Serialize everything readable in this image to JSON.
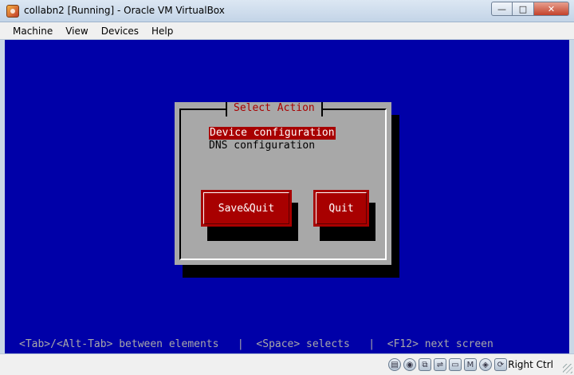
{
  "window": {
    "title": "collabn2 [Running] - Oracle VM VirtualBox",
    "minimize": "—",
    "maximize": "□",
    "close": "✕"
  },
  "menu": [
    "Machine",
    "View",
    "Devices",
    "Help"
  ],
  "dialog": {
    "title": "Select Action",
    "items": [
      "Device configuration",
      "DNS configuration"
    ],
    "selected_index": 0,
    "buttons": {
      "save_quit": "Save&Quit",
      "quit": "Quit"
    }
  },
  "helpline": "<Tab>/<Alt-Tab> between elements   |  <Space> selects   |  <F12> next screen",
  "statusbar": {
    "icons": [
      "hard-disk-icon",
      "optical-drive-icon",
      "network-icon",
      "usb-icon",
      "shared-folder-icon",
      "display-icon",
      "mouse-integration-icon",
      "host-key-icon"
    ],
    "host_key": "Right Ctrl"
  },
  "colors": {
    "vm_background": "#0000a8",
    "dialog_background": "#a8a8a8",
    "accent_red": "#a80000"
  }
}
